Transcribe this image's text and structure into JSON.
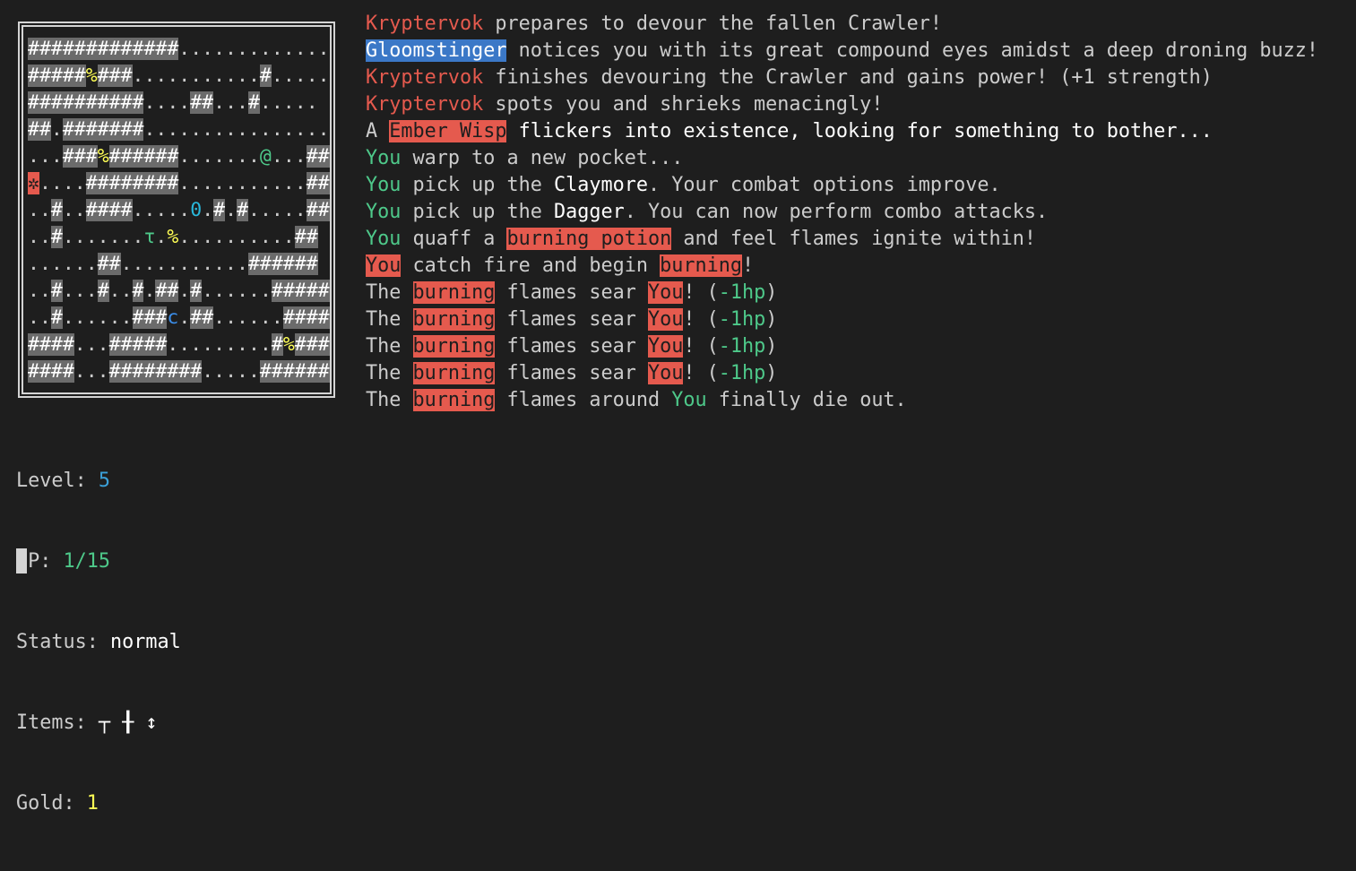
{
  "map_rows": [
    [
      [
        "w",
        "#############"
      ],
      [
        "d",
        "............."
      ]
    ],
    [
      [
        "w",
        "#####"
      ],
      [
        "yel",
        "%"
      ],
      [
        "w",
        "###"
      ],
      [
        "d",
        "..........."
      ],
      [
        "w",
        "#"
      ],
      [
        "d",
        "....."
      ]
    ],
    [
      [
        "w",
        "##########"
      ],
      [
        "d",
        "...."
      ],
      [
        "w",
        "##"
      ],
      [
        "d",
        "..."
      ],
      [
        "w",
        "#"
      ],
      [
        "d",
        "....."
      ]
    ],
    [
      [
        "w",
        "##"
      ],
      [
        "d",
        "."
      ],
      [
        "w",
        "#######"
      ],
      [
        "d",
        "................"
      ]
    ],
    [
      [
        "d",
        "..."
      ],
      [
        "w",
        "###"
      ],
      [
        "yel",
        "%"
      ],
      [
        "w",
        "######"
      ],
      [
        "d",
        "......."
      ],
      [
        "grn",
        "@"
      ],
      [
        "d",
        "..."
      ],
      [
        "w",
        "##"
      ]
    ],
    [
      [
        "redbg",
        "✲"
      ],
      [
        "d",
        "...."
      ],
      [
        "w",
        "########"
      ],
      [
        "d",
        "..........."
      ],
      [
        "w",
        "##"
      ]
    ],
    [
      [
        "d",
        ".."
      ],
      [
        "w",
        "#"
      ],
      [
        "d",
        ".."
      ],
      [
        "w",
        "####"
      ],
      [
        "d",
        "....."
      ],
      [
        "cyan",
        "0"
      ],
      [
        "d",
        "."
      ],
      [
        "w",
        "#"
      ],
      [
        "d",
        "."
      ],
      [
        "w",
        "#"
      ],
      [
        "d",
        "....."
      ],
      [
        "w",
        "##"
      ]
    ],
    [
      [
        "d",
        ".."
      ],
      [
        "w",
        "#"
      ],
      [
        "d",
        "......."
      ],
      [
        "grn",
        "τ"
      ],
      [
        "d",
        "."
      ],
      [
        "yel",
        "%"
      ],
      [
        "d",
        ".........."
      ],
      [
        "w",
        "##"
      ]
    ],
    [
      [
        "d",
        "......"
      ],
      [
        "w",
        "##"
      ],
      [
        "d",
        "..........."
      ],
      [
        "w",
        "######"
      ]
    ],
    [
      [
        "d",
        ".."
      ],
      [
        "w",
        "#"
      ],
      [
        "d",
        "..."
      ],
      [
        "w",
        "#"
      ],
      [
        "d",
        ".."
      ],
      [
        "w",
        "#"
      ],
      [
        "d",
        "."
      ],
      [
        "w",
        "##"
      ],
      [
        "d",
        "."
      ],
      [
        "w",
        "#"
      ],
      [
        "d",
        "......"
      ],
      [
        "w",
        "#####"
      ]
    ],
    [
      [
        "d",
        ".."
      ],
      [
        "w",
        "#"
      ],
      [
        "d",
        "......"
      ],
      [
        "w",
        "###"
      ],
      [
        "blu",
        "c"
      ],
      [
        "d",
        "."
      ],
      [
        "w",
        "##"
      ],
      [
        "d",
        "......"
      ],
      [
        "w",
        "####"
      ]
    ],
    [
      [
        "w",
        "####"
      ],
      [
        "d",
        "..."
      ],
      [
        "w",
        "#####"
      ],
      [
        "d",
        "........."
      ],
      [
        "w",
        "#"
      ],
      [
        "yel",
        "%"
      ],
      [
        "w",
        "###"
      ]
    ],
    [
      [
        "w",
        "####"
      ],
      [
        "d",
        "..."
      ],
      [
        "w",
        "########"
      ],
      [
        "d",
        "....."
      ],
      [
        "w",
        "######"
      ]
    ]
  ],
  "log": [
    [
      [
        "rtxt",
        "Kryptervok"
      ],
      [
        "n",
        " prepares to devour the fallen Crawler!"
      ]
    ],
    [
      [
        "hl-blue",
        "Gloomstinger"
      ],
      [
        "n",
        " notices you with its great compound eyes amidst a deep droning buzz!"
      ]
    ],
    [
      [
        "rtxt",
        "Kryptervok"
      ],
      [
        "n",
        " finishes devouring the Crawler and gains power! (+1 strength)"
      ]
    ],
    [
      [
        "rtxt",
        "Kryptervok"
      ],
      [
        "n",
        " spots you and shrieks menacingly!"
      ]
    ],
    [
      [
        "n",
        "A "
      ],
      [
        "hl-red",
        "Ember Wisp"
      ],
      [
        "bold",
        " flickers into existence, looking for something to bother..."
      ]
    ],
    [
      [
        "gtxt",
        "You"
      ],
      [
        "n",
        " warp to a new pocket..."
      ]
    ],
    [
      [
        "gtxt",
        "You"
      ],
      [
        "n",
        " pick up the "
      ],
      [
        "bold",
        "Claymore"
      ],
      [
        "n",
        ". Your combat options improve."
      ]
    ],
    [
      [
        "gtxt",
        "You"
      ],
      [
        "n",
        " pick up the "
      ],
      [
        "bold",
        "Dagger"
      ],
      [
        "n",
        ". You can now perform combo attacks."
      ]
    ],
    [
      [
        "gtxt",
        "You"
      ],
      [
        "n",
        " quaff a "
      ],
      [
        "hl-red",
        "burning potion"
      ],
      [
        "n",
        " and feel flames ignite within!"
      ]
    ],
    [
      [
        "hl-red",
        "You"
      ],
      [
        "n",
        " catch fire and begin "
      ],
      [
        "hl-red",
        "burning"
      ],
      [
        "n",
        "!"
      ]
    ],
    [
      [
        "n",
        "The "
      ],
      [
        "hl-red",
        "burning"
      ],
      [
        "n",
        " flames sear "
      ],
      [
        "hl-red",
        "You"
      ],
      [
        "n",
        "! ("
      ],
      [
        "gtxt",
        "-1hp"
      ],
      [
        "n",
        ")"
      ]
    ],
    [
      [
        "n",
        "The "
      ],
      [
        "hl-red",
        "burning"
      ],
      [
        "n",
        " flames sear "
      ],
      [
        "hl-red",
        "You"
      ],
      [
        "n",
        "! ("
      ],
      [
        "gtxt",
        "-1hp"
      ],
      [
        "n",
        ")"
      ]
    ],
    [
      [
        "n",
        "The "
      ],
      [
        "hl-red",
        "burning"
      ],
      [
        "n",
        " flames sear "
      ],
      [
        "hl-red",
        "You"
      ],
      [
        "n",
        "! ("
      ],
      [
        "gtxt",
        "-1hp"
      ],
      [
        "n",
        ")"
      ]
    ],
    [
      [
        "n",
        "The "
      ],
      [
        "hl-red",
        "burning"
      ],
      [
        "n",
        " flames sear "
      ],
      [
        "hl-red",
        "You"
      ],
      [
        "n",
        "! ("
      ],
      [
        "gtxt",
        "-1hp"
      ],
      [
        "n",
        ")"
      ]
    ],
    [
      [
        "n",
        "The "
      ],
      [
        "hl-red",
        "burning"
      ],
      [
        "n",
        " flames around "
      ],
      [
        "gtxt",
        "You"
      ],
      [
        "n",
        " finally die out."
      ]
    ]
  ],
  "stats": {
    "level_label": "Level: ",
    "level_value": "5",
    "hp_label": "HP: ",
    "hp_value": "1/15",
    "status_label": "Status: ",
    "status_value": "normal",
    "items_label": "Items: ",
    "items_value": "┬ ╂ ↕",
    "gold_label": "Gold: ",
    "gold_value": "1"
  },
  "colors": {
    "background": "#1e1e1e",
    "text": "#cccccc",
    "wall_bg": "#6b6b6b",
    "red": "#e55a4e",
    "green": "#4ec98a",
    "blue_highlight": "#3b78c7",
    "yellow": "#ffff55"
  }
}
